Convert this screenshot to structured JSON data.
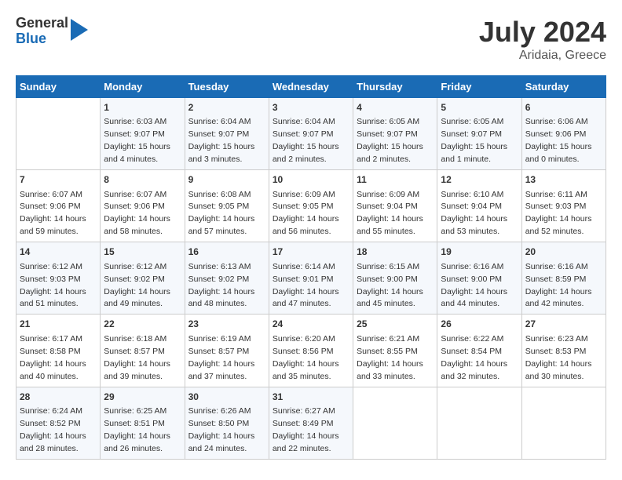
{
  "header": {
    "logo_general": "General",
    "logo_blue": "Blue",
    "main_title": "July 2024",
    "subtitle": "Aridaia, Greece"
  },
  "days_of_week": [
    "Sunday",
    "Monday",
    "Tuesday",
    "Wednesday",
    "Thursday",
    "Friday",
    "Saturday"
  ],
  "weeks": [
    [
      {
        "day": "",
        "content": ""
      },
      {
        "day": "1",
        "content": "Sunrise: 6:03 AM\nSunset: 9:07 PM\nDaylight: 15 hours\nand 4 minutes."
      },
      {
        "day": "2",
        "content": "Sunrise: 6:04 AM\nSunset: 9:07 PM\nDaylight: 15 hours\nand 3 minutes."
      },
      {
        "day": "3",
        "content": "Sunrise: 6:04 AM\nSunset: 9:07 PM\nDaylight: 15 hours\nand 2 minutes."
      },
      {
        "day": "4",
        "content": "Sunrise: 6:05 AM\nSunset: 9:07 PM\nDaylight: 15 hours\nand 2 minutes."
      },
      {
        "day": "5",
        "content": "Sunrise: 6:05 AM\nSunset: 9:07 PM\nDaylight: 15 hours\nand 1 minute."
      },
      {
        "day": "6",
        "content": "Sunrise: 6:06 AM\nSunset: 9:06 PM\nDaylight: 15 hours\nand 0 minutes."
      }
    ],
    [
      {
        "day": "7",
        "content": "Sunrise: 6:07 AM\nSunset: 9:06 PM\nDaylight: 14 hours\nand 59 minutes."
      },
      {
        "day": "8",
        "content": "Sunrise: 6:07 AM\nSunset: 9:06 PM\nDaylight: 14 hours\nand 58 minutes."
      },
      {
        "day": "9",
        "content": "Sunrise: 6:08 AM\nSunset: 9:05 PM\nDaylight: 14 hours\nand 57 minutes."
      },
      {
        "day": "10",
        "content": "Sunrise: 6:09 AM\nSunset: 9:05 PM\nDaylight: 14 hours\nand 56 minutes."
      },
      {
        "day": "11",
        "content": "Sunrise: 6:09 AM\nSunset: 9:04 PM\nDaylight: 14 hours\nand 55 minutes."
      },
      {
        "day": "12",
        "content": "Sunrise: 6:10 AM\nSunset: 9:04 PM\nDaylight: 14 hours\nand 53 minutes."
      },
      {
        "day": "13",
        "content": "Sunrise: 6:11 AM\nSunset: 9:03 PM\nDaylight: 14 hours\nand 52 minutes."
      }
    ],
    [
      {
        "day": "14",
        "content": "Sunrise: 6:12 AM\nSunset: 9:03 PM\nDaylight: 14 hours\nand 51 minutes."
      },
      {
        "day": "15",
        "content": "Sunrise: 6:12 AM\nSunset: 9:02 PM\nDaylight: 14 hours\nand 49 minutes."
      },
      {
        "day": "16",
        "content": "Sunrise: 6:13 AM\nSunset: 9:02 PM\nDaylight: 14 hours\nand 48 minutes."
      },
      {
        "day": "17",
        "content": "Sunrise: 6:14 AM\nSunset: 9:01 PM\nDaylight: 14 hours\nand 47 minutes."
      },
      {
        "day": "18",
        "content": "Sunrise: 6:15 AM\nSunset: 9:00 PM\nDaylight: 14 hours\nand 45 minutes."
      },
      {
        "day": "19",
        "content": "Sunrise: 6:16 AM\nSunset: 9:00 PM\nDaylight: 14 hours\nand 44 minutes."
      },
      {
        "day": "20",
        "content": "Sunrise: 6:16 AM\nSunset: 8:59 PM\nDaylight: 14 hours\nand 42 minutes."
      }
    ],
    [
      {
        "day": "21",
        "content": "Sunrise: 6:17 AM\nSunset: 8:58 PM\nDaylight: 14 hours\nand 40 minutes."
      },
      {
        "day": "22",
        "content": "Sunrise: 6:18 AM\nSunset: 8:57 PM\nDaylight: 14 hours\nand 39 minutes."
      },
      {
        "day": "23",
        "content": "Sunrise: 6:19 AM\nSunset: 8:57 PM\nDaylight: 14 hours\nand 37 minutes."
      },
      {
        "day": "24",
        "content": "Sunrise: 6:20 AM\nSunset: 8:56 PM\nDaylight: 14 hours\nand 35 minutes."
      },
      {
        "day": "25",
        "content": "Sunrise: 6:21 AM\nSunset: 8:55 PM\nDaylight: 14 hours\nand 33 minutes."
      },
      {
        "day": "26",
        "content": "Sunrise: 6:22 AM\nSunset: 8:54 PM\nDaylight: 14 hours\nand 32 minutes."
      },
      {
        "day": "27",
        "content": "Sunrise: 6:23 AM\nSunset: 8:53 PM\nDaylight: 14 hours\nand 30 minutes."
      }
    ],
    [
      {
        "day": "28",
        "content": "Sunrise: 6:24 AM\nSunset: 8:52 PM\nDaylight: 14 hours\nand 28 minutes."
      },
      {
        "day": "29",
        "content": "Sunrise: 6:25 AM\nSunset: 8:51 PM\nDaylight: 14 hours\nand 26 minutes."
      },
      {
        "day": "30",
        "content": "Sunrise: 6:26 AM\nSunset: 8:50 PM\nDaylight: 14 hours\nand 24 minutes."
      },
      {
        "day": "31",
        "content": "Sunrise: 6:27 AM\nSunset: 8:49 PM\nDaylight: 14 hours\nand 22 minutes."
      },
      {
        "day": "",
        "content": ""
      },
      {
        "day": "",
        "content": ""
      },
      {
        "day": "",
        "content": ""
      }
    ]
  ]
}
